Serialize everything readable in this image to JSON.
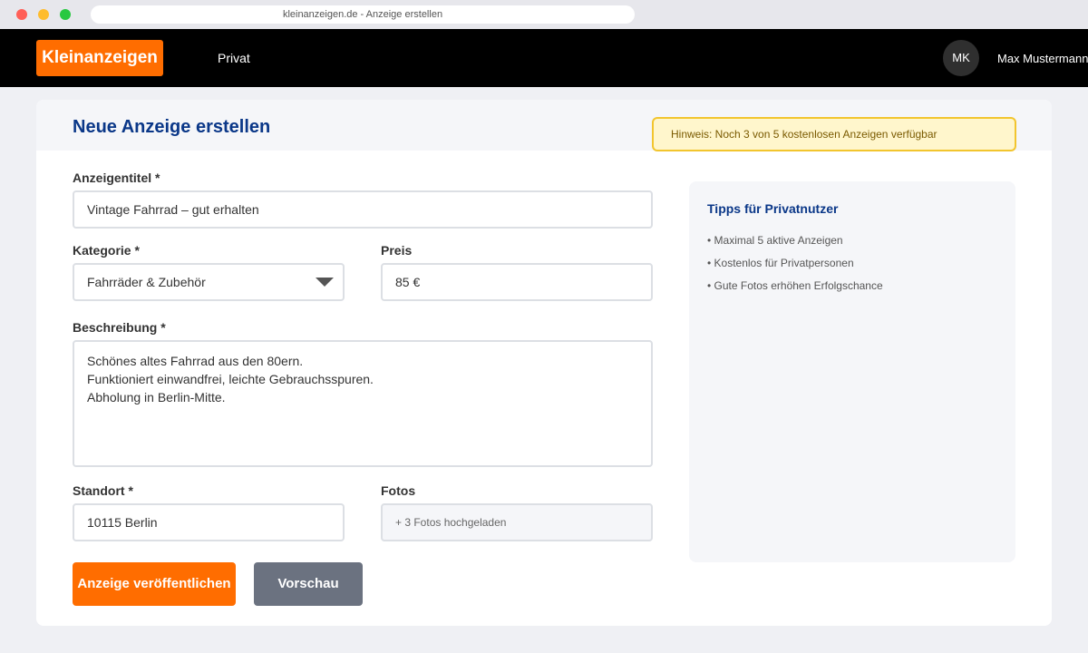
{
  "browser": {
    "url_title": "kleinanzeigen.de - Anzeige erstellen"
  },
  "header": {
    "logo": "Kleinanzeigen",
    "nav_link": "Privat",
    "avatar_initials": "MK",
    "username": "Max Mustermann"
  },
  "page": {
    "title": "Neue Anzeige erstellen",
    "notice": "Hinweis: Noch 3 von 5 kostenlosen Anzeigen verfügbar"
  },
  "form": {
    "title_label": "Anzeigentitel *",
    "title_value": "Vintage Fahrrad – gut erhalten",
    "category_label": "Kategorie *",
    "category_value": "Fahrräder & Zubehör",
    "price_label": "Preis",
    "price_value": "85 €",
    "description_label": "Beschreibung *",
    "description_lines": [
      "Schönes altes Fahrrad aus den 80ern.",
      "Funktioniert einwandfrei, leichte Gebrauchsspuren.",
      "Abholung in Berlin-Mitte."
    ],
    "location_label": "Standort *",
    "location_value": "10115 Berlin",
    "photos_label": "Fotos",
    "photos_value": "+ 3 Fotos hochgeladen",
    "publish_button": "Anzeige veröffentlichen",
    "preview_button": "Vorschau"
  },
  "tips": {
    "title": "Tipps für Privatnutzer",
    "items": [
      "• Maximal 5 aktive Anzeigen",
      "• Kostenlos für Privatpersonen",
      "• Gute Fotos erhöhen Erfolgschance"
    ]
  },
  "colors": {
    "brand": "#ff6d00",
    "nav_bg": "#000000",
    "title": "#0a3788",
    "notice_bg": "#fff6cc",
    "notice_border": "#f2c52e",
    "secondary_button": "#6b7280"
  }
}
